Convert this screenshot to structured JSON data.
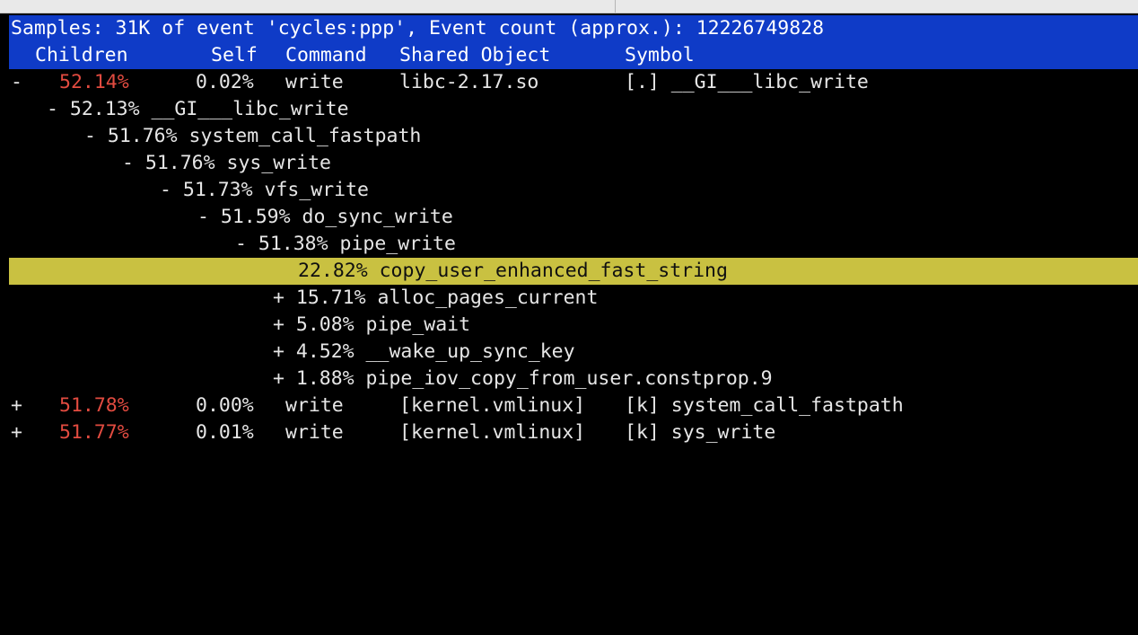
{
  "header": {
    "summary": "Samples: 31K of event 'cycles:ppp', Event count (approx.): 12226749828",
    "columns": [
      "Children",
      "Self",
      "Command",
      "Shared Object",
      "Symbol"
    ]
  },
  "top_entry": {
    "fold": "-",
    "children": "52.14%",
    "self": "0.02%",
    "command": "write",
    "shared_object": "libc-2.17.so",
    "symbol": "[.] __GI___libc_write"
  },
  "tree": [
    {
      "text": "- 52.13% __GI___libc_write"
    },
    {
      "text": "- 51.76% system_call_fastpath"
    },
    {
      "text": "- 51.76% sys_write"
    },
    {
      "text": "- 51.73% vfs_write"
    },
    {
      "text": "- 51.59% do_sync_write"
    },
    {
      "text": "- 51.38% pipe_write"
    },
    {
      "text": "22.82% copy_user_enhanced_fast_string"
    },
    {
      "text": "+ 15.71% alloc_pages_current"
    },
    {
      "text": "+ 5.08% pipe_wait"
    },
    {
      "text": "+ 4.52% __wake_up_sync_key"
    },
    {
      "text": "+ 1.88% pipe_iov_copy_from_user.constprop.9"
    }
  ],
  "entries": [
    {
      "fold": "+",
      "children": "51.78%",
      "self": "0.00%",
      "command": "write",
      "shared_object": "[kernel.vmlinux]",
      "symbol": "[k] system_call_fastpath"
    },
    {
      "fold": "+",
      "children": "51.77%",
      "self": "0.01%",
      "command": "write",
      "shared_object": "[kernel.vmlinux]",
      "symbol": "[k] sys_write"
    }
  ],
  "colors": {
    "header_bg": "#0f3bc7",
    "highlight_bg": "#c9c141",
    "children_pct": "#e24b40",
    "background": "#000000"
  }
}
